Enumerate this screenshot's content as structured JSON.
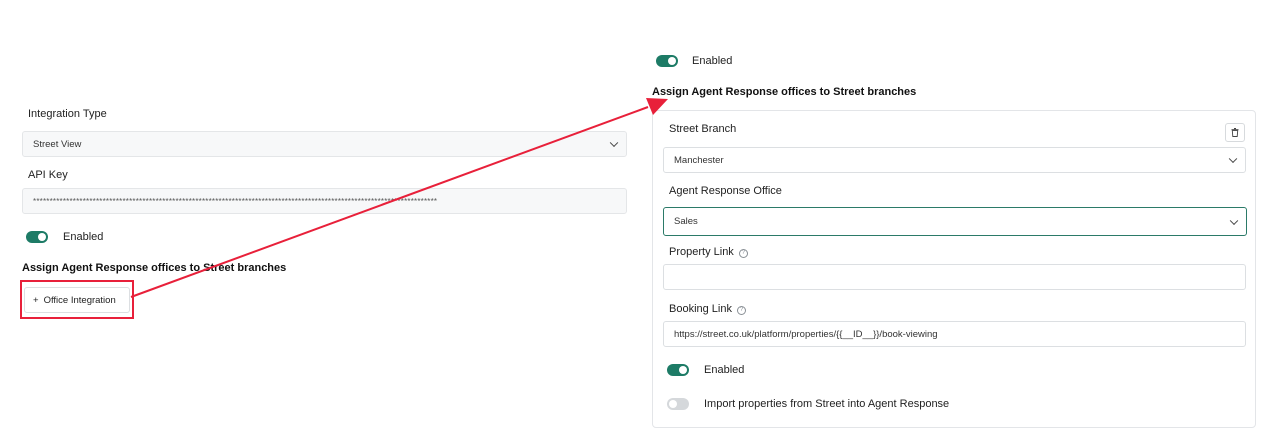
{
  "left": {
    "integration_type_label": "Integration Type",
    "integration_type_value": "Street View",
    "api_key_label": "API Key",
    "api_key_value": "**************************************************************************************************************************",
    "enabled_label": "Enabled",
    "enabled_on": true,
    "assign_heading": "Assign Agent Response offices to Street branches",
    "add_button_plus": "+",
    "add_button_label": "Office Integration"
  },
  "right": {
    "enabled_label": "Enabled",
    "enabled_on": true,
    "assign_heading": "Assign Agent Response offices to Street branches",
    "panel": {
      "street_branch_label": "Street Branch",
      "street_branch_value": "Manchester",
      "agent_office_label": "Agent Response Office",
      "agent_office_value": "Sales",
      "property_link_label": "Property Link",
      "property_link_value": "",
      "booking_link_label": "Booking Link",
      "booking_link_value": "https://street.co.uk/platform/properties/{{__ID__}}/book-viewing",
      "enabled_label": "Enabled",
      "enabled_on": true,
      "import_label": "Import properties from Street into Agent Response",
      "import_on": false
    }
  },
  "annotation": {
    "color": "#e8203a",
    "icons": [
      "chevron-down-icon",
      "trash-icon",
      "help-circle-icon",
      "plus-icon",
      "arrow-annotation"
    ]
  }
}
